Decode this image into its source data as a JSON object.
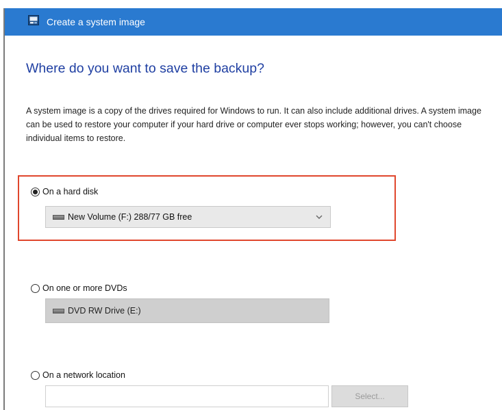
{
  "window": {
    "title": "Create a system image",
    "titlebar_color": "#2a7ad0",
    "icon": "system-image-icon"
  },
  "main": {
    "heading": "Where do you want to save the backup?",
    "description": "A system image is a copy of the drives required for Windows to run. It can also include additional drives. A system image can be used to restore your computer if your hard drive or computer ever stops working; however, you can't choose individual items to restore.",
    "highlight_color": "#e0462c"
  },
  "options": {
    "hard_disk": {
      "label": "On a hard disk",
      "selected": true,
      "dropdown_value": "New Volume (F:)  288/77 GB free",
      "drive_icon": "drive-icon",
      "chevron_icon": "chevron-down-icon"
    },
    "dvd": {
      "label": "On one or more DVDs",
      "selected": false,
      "dropdown_value": "DVD RW Drive (E:)",
      "drive_icon": "drive-icon"
    },
    "network": {
      "label": "On a network location",
      "selected": false,
      "path_value": "",
      "select_button": "Select..."
    }
  }
}
